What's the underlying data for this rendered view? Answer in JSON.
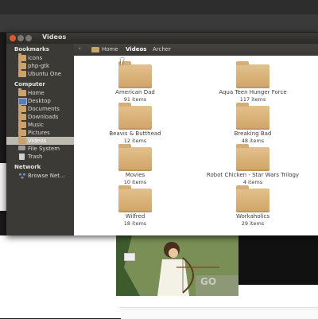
{
  "window": {
    "title": "Videos"
  },
  "sidebar": {
    "bookmarks_heading": "Bookmarks",
    "bookmarks": [
      {
        "label": "icons",
        "icon": "folder-icon"
      },
      {
        "label": "php-gtk",
        "icon": "folder-icon"
      },
      {
        "label": "Ubuntu One",
        "icon": "folder-icon"
      }
    ],
    "computer_heading": "Computer",
    "computer": [
      {
        "label": "Home",
        "icon": "home-folder-icon"
      },
      {
        "label": "Desktop",
        "icon": "desktop-icon"
      },
      {
        "label": "Documents",
        "icon": "documents-folder-icon"
      },
      {
        "label": "Downloads",
        "icon": "downloads-folder-icon"
      },
      {
        "label": "Music",
        "icon": "music-folder-icon"
      },
      {
        "label": "Pictures",
        "icon": "pictures-folder-icon"
      },
      {
        "label": "Videos",
        "icon": "videos-folder-icon",
        "active": true
      },
      {
        "label": "File System",
        "icon": "harddisk-icon"
      },
      {
        "label": "Trash",
        "icon": "trash-icon"
      }
    ],
    "network_heading": "Network",
    "network": [
      {
        "label": "Browse Net...",
        "icon": "network-icon"
      }
    ]
  },
  "toolbar": {
    "breadcrumbs": [
      "Home",
      "Videos",
      "Archer"
    ],
    "active_crumb": "Videos"
  },
  "folders": [
    {
      "name": "American Dad",
      "count": "91 items"
    },
    {
      "name": "Aqua Teen Hunger Force",
      "count": "117 items"
    },
    {
      "name": "Beavis & Butthead",
      "count": "12 items"
    },
    {
      "name": "Breaking Bad",
      "count": "48 items"
    },
    {
      "name": "Movies",
      "count": "10 items"
    },
    {
      "name": "Robot Chicken - Star Wars Trilogy",
      "count": "4 items"
    },
    {
      "name": "Wilfred",
      "count": "18 items"
    },
    {
      "name": "Workaholics",
      "count": "29 items"
    }
  ],
  "colors": {
    "sidebar_bg": "#3b3a36",
    "selection": "#bdbab1",
    "folder": "#d6ae74",
    "close_button": "#e0582b"
  }
}
